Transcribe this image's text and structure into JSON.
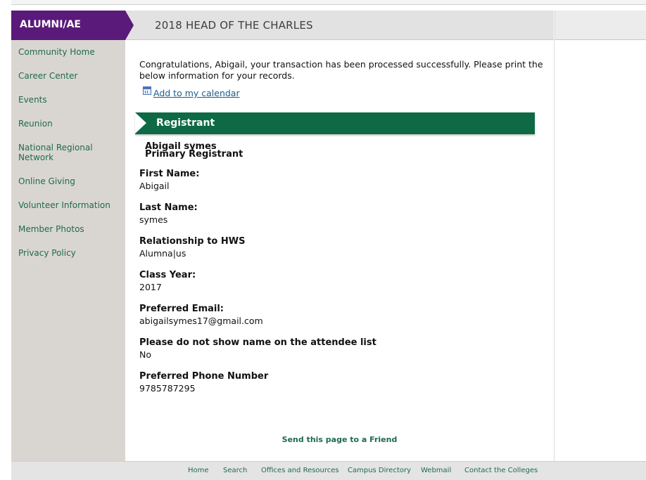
{
  "sidebar": {
    "header": "ALUMNI/AE",
    "items": [
      {
        "label": "Community Home"
      },
      {
        "label": "Career Center"
      },
      {
        "label": "Events"
      },
      {
        "label": "Reunion"
      },
      {
        "label": "National Regional Network"
      },
      {
        "label": "Online Giving"
      },
      {
        "label": "Volunteer Information"
      },
      {
        "label": "Member Photos"
      },
      {
        "label": "Privacy Policy"
      }
    ]
  },
  "header": {
    "title": "2018 HEAD OF THE CHARLES"
  },
  "main": {
    "confirmation": "Congratulations, Abigail, your transaction has been processed successfully. Please print the below information for your records.",
    "calendar_link": "Add to my calendar",
    "section_title": "Registrant",
    "registrant_name": "Abigail symes",
    "registrant_role": "Primary Registrant",
    "fields": [
      {
        "label": "First Name:",
        "value": "Abigail"
      },
      {
        "label": "Last Name:",
        "value": "symes"
      },
      {
        "label": "Relationship to HWS",
        "value": "Alumna|us"
      },
      {
        "label": "Class Year:",
        "value": "2017"
      },
      {
        "label": "Preferred Email:",
        "value": "abigailsymes17@gmail.com"
      },
      {
        "label": "Please do not show name on the attendee list",
        "value": "No"
      },
      {
        "label": "Preferred Phone Number",
        "value": "9785787295"
      }
    ],
    "send_link": "Send this page to a Friend"
  },
  "footer": {
    "links": [
      "Home",
      "Search",
      "Offices and Resources",
      "Campus Directory",
      "Webmail",
      "Contact the Colleges"
    ]
  },
  "colors": {
    "brand_purple": "#5a1a7a",
    "section_green": "#0d6a45",
    "link_green": "#1f6a4c",
    "sidebar_bg": "#d9d6d2"
  }
}
